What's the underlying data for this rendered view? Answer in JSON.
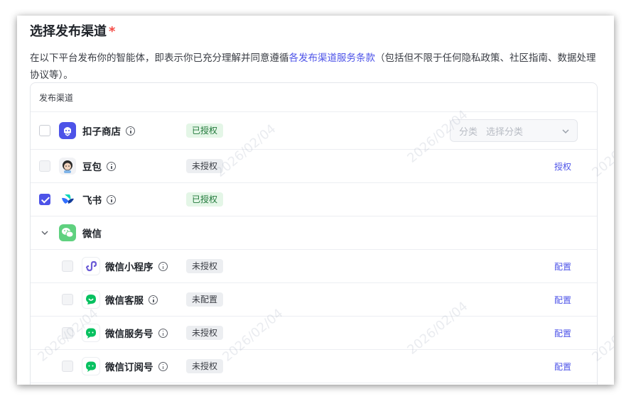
{
  "header": {
    "title": "选择发布渠道",
    "required_mark": "*",
    "desc_prefix": "在以下平台发布你的智能体，即表示你已充分理解并同意遵循",
    "desc_link": "各发布渠道服务条款",
    "desc_suffix": "（包括但不限于任何隐私政策、社区指南、数据处理协议等）。"
  },
  "table": {
    "header_label": "发布渠道",
    "category_select": {
      "label": "分类",
      "placeholder": "选择分类"
    },
    "rows": [
      {
        "name": "扣子商店",
        "status": "已授权",
        "checked": false,
        "icon": "coze-store-icon"
      },
      {
        "name": "豆包",
        "status": "未授权",
        "checked": false,
        "action": "授权",
        "icon": "doubao-icon"
      },
      {
        "name": "飞书",
        "status": "已授权",
        "checked": true,
        "icon": "feishu-icon"
      },
      {
        "name": "微信",
        "group": true,
        "expanded": true,
        "icon": "wechat-icon"
      }
    ],
    "sub_rows": [
      {
        "name": "微信小程序",
        "status": "未授权",
        "action": "配置",
        "icon": "mini-program-icon"
      },
      {
        "name": "微信客服",
        "status": "未配置",
        "action": "配置",
        "icon": "wechat-customer-service-icon"
      },
      {
        "name": "微信服务号",
        "status": "未授权",
        "action": "配置",
        "icon": "wechat-service-account-icon"
      },
      {
        "name": "微信订阅号",
        "status": "未授权",
        "action": "配置",
        "icon": "wechat-subscription-icon"
      }
    ]
  },
  "watermark": {
    "text": "2026/02/04"
  },
  "colors": {
    "accent": "#4d53e8",
    "authorized_bg": "#e4f6e7",
    "authorized_fg": "#20783a",
    "wechat_green": "#07c160"
  }
}
